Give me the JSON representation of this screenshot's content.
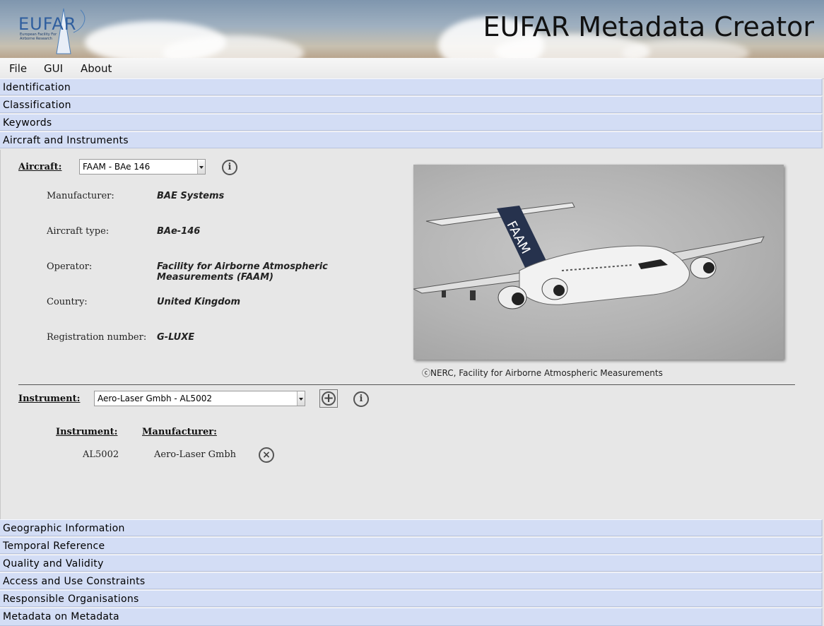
{
  "banner": {
    "app_title": "EUFAR Metadata Creator",
    "logo_text": "EUFAR",
    "logo_subtitle": "European Facility For Airborne Research"
  },
  "menu": {
    "items": [
      {
        "label": "File"
      },
      {
        "label": "GUI"
      },
      {
        "label": "About"
      }
    ]
  },
  "sections_top": [
    {
      "label": "Identification"
    },
    {
      "label": "Classification"
    },
    {
      "label": "Keywords"
    },
    {
      "label": "Aircraft and Instruments"
    }
  ],
  "aircraft": {
    "label": "Aircraft:",
    "selected": "FAAM - BAe 146",
    "details": [
      {
        "label": "Manufacturer:",
        "value": "BAE Systems"
      },
      {
        "label": "Aircraft type:",
        "value": "BAe-146"
      },
      {
        "label": "Operator:",
        "value": "Facility for Airborne Atmospheric Measurements (FAAM)"
      },
      {
        "label": "Country:",
        "value": "United Kingdom"
      },
      {
        "label": "Registration number:",
        "value": "G-LUXE"
      }
    ],
    "photo_credit": "ⓒNERC, Facility for Airborne Atmospheric Measurements",
    "tail_text": "FAAM"
  },
  "instrument": {
    "label": "Instrument:",
    "selected": "Aero-Laser Gmbh - AL5002",
    "table": {
      "headers": [
        "Instrument:",
        "Manufacturer:"
      ],
      "rows": [
        {
          "instrument": "AL5002",
          "manufacturer": "Aero-Laser Gmbh"
        }
      ]
    }
  },
  "sections_bottom": [
    {
      "label": "Geographic Information"
    },
    {
      "label": "Temporal Reference"
    },
    {
      "label": "Quality and Validity"
    },
    {
      "label": "Access and Use Constraints"
    },
    {
      "label": "Responsible Organisations"
    },
    {
      "label": "Metadata on Metadata"
    }
  ],
  "icons": {
    "info": "info-icon",
    "add": "add-icon",
    "remove": "remove-icon"
  },
  "colors": {
    "section_header": "#d3ddf5",
    "content_bg": "#e7e7e7"
  }
}
